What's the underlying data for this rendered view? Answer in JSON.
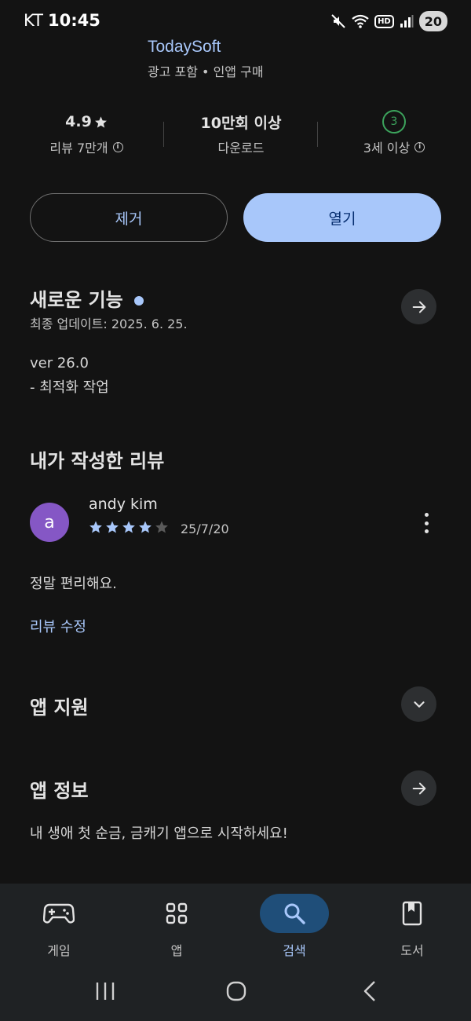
{
  "status_bar": {
    "carrier": "KT",
    "time": "10:45",
    "battery": "20",
    "network_badge": "HD"
  },
  "app": {
    "developer": "TodaySoft",
    "meta": "광고 포함 • 인앱 구매"
  },
  "stats": {
    "rating": {
      "value": "4.9",
      "label": "리뷰 7만개"
    },
    "downloads": {
      "value": "10만회 이상",
      "label": "다운로드"
    },
    "age": {
      "badge": "3",
      "label": "3세 이상"
    }
  },
  "buttons": {
    "remove": "제거",
    "open": "열기"
  },
  "whats_new": {
    "title": "새로운 기능",
    "updated": "최종 업데이트: 2025. 6. 25.",
    "notes": [
      "ver 26.0",
      "- 최적화 작업"
    ]
  },
  "my_review": {
    "title": "내가 작성한 리뷰",
    "avatar_letter": "a",
    "reviewer": "andy kim",
    "rating": 4,
    "max_rating": 5,
    "date": "25/7/20",
    "text": "정말 편리해요.",
    "edit_link": "리뷰 수정"
  },
  "app_support": {
    "title": "앱 지원"
  },
  "app_info": {
    "title": "앱 정보",
    "description": "내 생애 첫 순금, 금캐기 앱으로 시작하세요!"
  },
  "bottom_nav": {
    "items": [
      {
        "label": "게임",
        "icon": "gamepad-icon"
      },
      {
        "label": "앱",
        "icon": "apps-grid-icon"
      },
      {
        "label": "검색",
        "icon": "search-icon",
        "active": true
      },
      {
        "label": "도서",
        "icon": "book-icon"
      }
    ]
  },
  "colors": {
    "accent": "#a8c7fa",
    "background": "#131313",
    "avatar": "#8557c5",
    "age_badge": "#3ca35c",
    "active_pill": "#1f4e79"
  }
}
